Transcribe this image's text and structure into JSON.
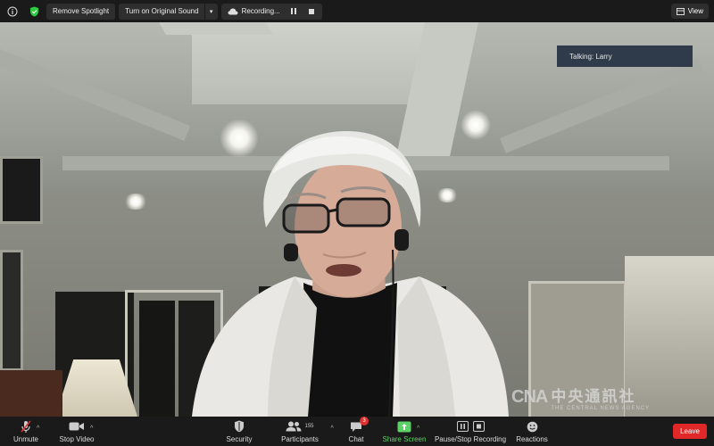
{
  "topbar": {
    "info_icon": "info-icon",
    "shield_icon": "shield-check-icon",
    "remove_spotlight_label": "Remove Spotlight",
    "original_sound_label": "Turn on Original Sound",
    "recording_label": "Recording...",
    "view_label": "View"
  },
  "video": {
    "talking_label": "Talking: Larry",
    "watermark_logo": "CNA",
    "watermark_cn": "中央通訊社",
    "watermark_en": "THE CENTRAL NEWS AGENCY"
  },
  "bottombar": {
    "unmute_label": "Unmute",
    "stop_video_label": "Stop Video",
    "security_label": "Security",
    "participants_label": "Participants",
    "participants_count": "155",
    "chat_label": "Chat",
    "chat_badge": "3",
    "share_screen_label": "Share Screen",
    "recording_label": "Pause/Stop Recording",
    "reactions_label": "Reactions",
    "leave_label": "Leave"
  },
  "colors": {
    "bar_bg": "#1a1a1a",
    "share_green": "#5cd166",
    "leave_red": "#e02828",
    "mute_red": "#e02f2f",
    "shield_green": "#2ecc40"
  }
}
